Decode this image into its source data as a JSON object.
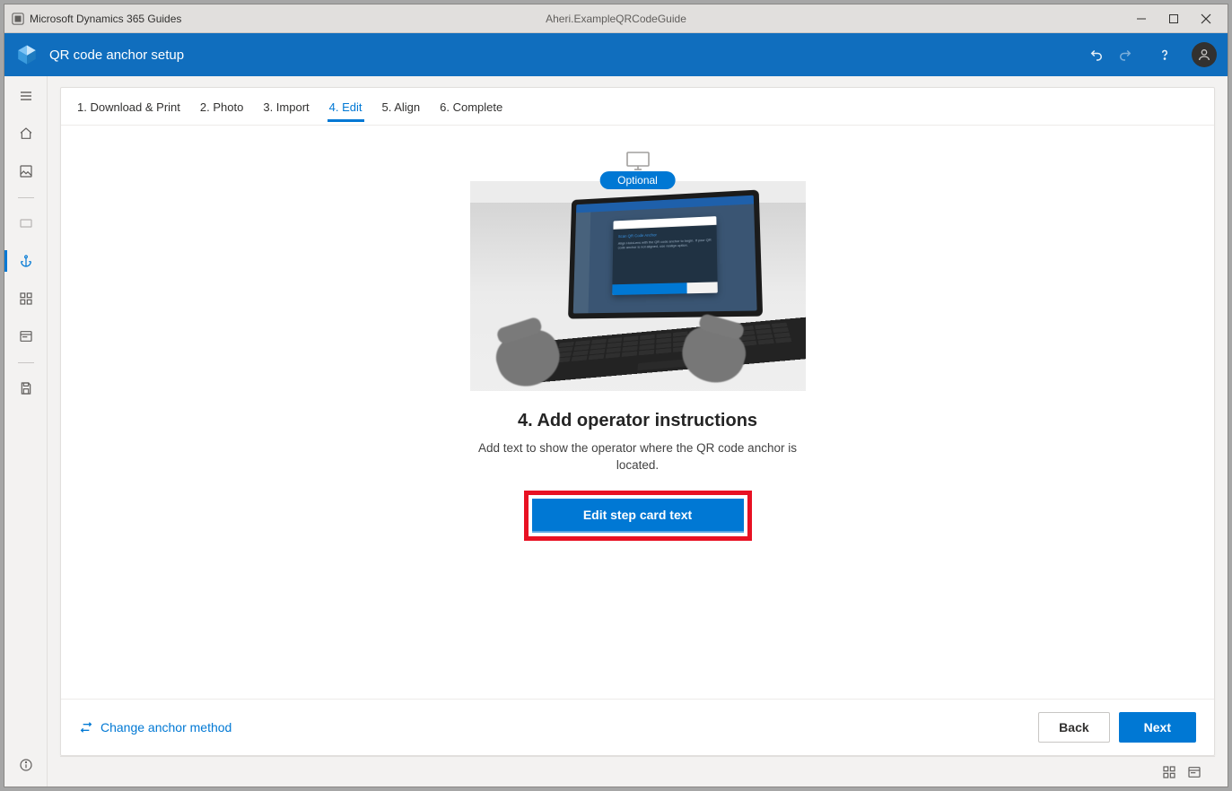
{
  "titlebar": {
    "app_name": "Microsoft Dynamics 365 Guides",
    "document_title": "Aheri.ExampleQRCodeGuide"
  },
  "header": {
    "page_title": "QR code anchor setup"
  },
  "tabs": [
    {
      "label": "1. Download & Print",
      "active": false
    },
    {
      "label": "2. Photo",
      "active": false
    },
    {
      "label": "3. Import",
      "active": false
    },
    {
      "label": "4. Edit",
      "active": true
    },
    {
      "label": "5. Align",
      "active": false
    },
    {
      "label": "6. Complete",
      "active": false
    }
  ],
  "hero": {
    "pill": "Optional",
    "dialog_accent": "Scan QR Code Anchor",
    "dialog_lines": "Align HoloLens with the QR code anchor to begin. If your QR code anchor is not aligned, use realign option."
  },
  "step": {
    "title": "4. Add operator instructions",
    "desc": "Add text to show the operator where the QR code anchor is located.",
    "button": "Edit step card text"
  },
  "footer": {
    "change_link": "Change anchor method",
    "back": "Back",
    "next": "Next"
  }
}
